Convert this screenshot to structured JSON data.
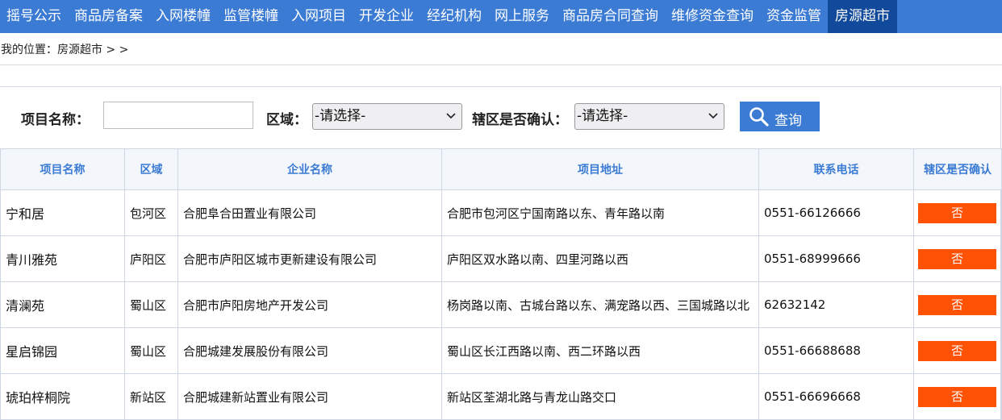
{
  "nav": {
    "items": [
      "摇号公示",
      "商品房备案",
      "入网楼幢",
      "监管楼幢",
      "入网项目",
      "开发企业",
      "经纪机构",
      "网上服务",
      "商品房合同查询",
      "维修资金查询",
      "资金监管",
      "房源超市"
    ],
    "active_index": 11
  },
  "breadcrumb": {
    "text": "我的位置：房源超市 > >"
  },
  "search": {
    "project_label": "项目名称：",
    "project_value": "",
    "district_label": "区域：",
    "district_selected": "-请选择-",
    "confirm_label": "辖区是否确认：",
    "confirm_selected": "-请选择-",
    "query_button": "查询"
  },
  "table": {
    "headers": [
      "项目名称",
      "区域",
      "企业名称",
      "项目地址",
      "联系电话",
      "辖区是否确认"
    ],
    "rows": [
      {
        "name": "宁和居",
        "district": "包河区",
        "company": "合肥阜合田置业有限公司",
        "address": "合肥市包河区宁国南路以东、青年路以南",
        "phone": "0551-66126666",
        "confirmed": "否"
      },
      {
        "name": "青川雅苑",
        "district": "庐阳区",
        "company": "合肥市庐阳区城市更新建设有限公司",
        "address": "庐阳区双水路以南、四里河路以西",
        "phone": "0551-68999666",
        "confirmed": "否"
      },
      {
        "name": "清澜苑",
        "district": "蜀山区",
        "company": "合肥市庐阳房地产开发公司",
        "address": "杨岗路以南、古城台路以东、满宠路以西、三国城路以北",
        "phone": "62632142",
        "confirmed": "否"
      },
      {
        "name": "星启锦园",
        "district": "蜀山区",
        "company": "合肥城建发展股份有限公司",
        "address": "蜀山区长江西路以南、西二环路以西",
        "phone": "0551-66688688",
        "confirmed": "否"
      },
      {
        "name": "琥珀梓桐院",
        "district": "新站区",
        "company": "合肥城建新站置业有限公司",
        "address": "新站区荃湖北路与青龙山路交口",
        "phone": "0551-66696668",
        "confirmed": "否"
      }
    ]
  },
  "colors": {
    "nav_bg": "#3b7bd4",
    "nav_active_bg": "#124a9b",
    "header_text": "#3b7bd4",
    "badge_bg": "#ff5205"
  },
  "icons": {
    "query_button_icon": "search-icon",
    "select_arrow": "chevron-down-icon"
  }
}
